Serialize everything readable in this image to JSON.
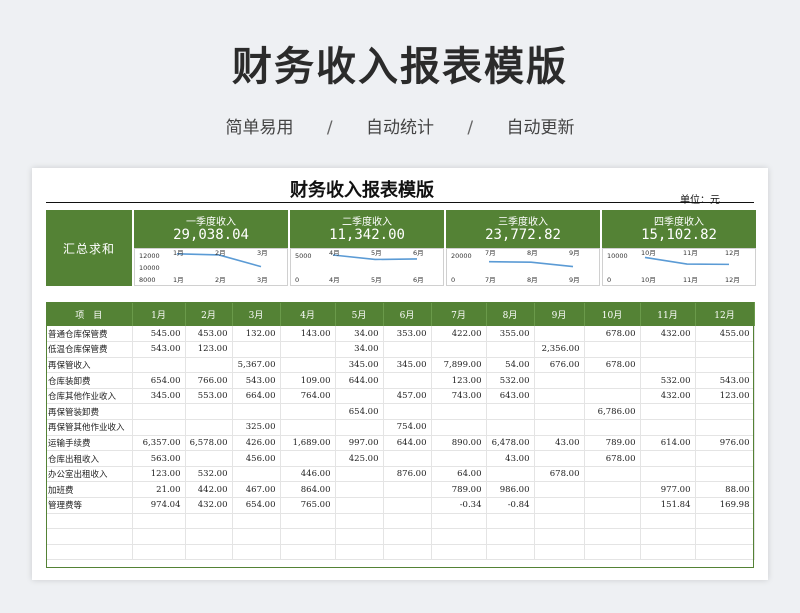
{
  "header": {
    "title": "财务收入报表模版"
  },
  "subtitle": {
    "items": [
      "简单易用",
      "自动统计",
      "自动更新"
    ],
    "separator": "/"
  },
  "sheet": {
    "title": "财务收入报表模版",
    "unit": "单位：元"
  },
  "summary": {
    "label": "汇总求和",
    "quarters": [
      {
        "name": "一季度收入",
        "total": "29,038.04",
        "months": [
          "1月",
          "2月",
          "3月"
        ],
        "values": [
          12345.0,
          12012.0,
          8678.0
        ],
        "ticks": [
          "12000",
          "10000",
          "8000"
        ]
      },
      {
        "name": "二季度收入",
        "total": "11,342.00",
        "months": [
          "4月",
          "5月",
          "6月"
        ],
        "values": [
          5000,
          3400,
          3600
        ],
        "ticks": [
          "5000",
          "0"
        ]
      },
      {
        "name": "三季度收入",
        "total": "23,772.82",
        "months": [
          "7月",
          "8月",
          "9月"
        ],
        "values": [
          10500,
          9700,
          3500
        ],
        "ticks": [
          "20000",
          "0"
        ]
      },
      {
        "name": "四季度收入",
        "total": "15,102.82",
        "months": [
          "10月",
          "11月",
          "12月"
        ],
        "values": [
          8254,
          3548,
          3300
        ],
        "ticks": [
          "10000",
          "0"
        ]
      }
    ]
  },
  "table": {
    "headers": [
      "项　目",
      "1月",
      "2月",
      "3月",
      "4月",
      "5月",
      "6月",
      "7月",
      "8月",
      "9月",
      "10月",
      "11月",
      "12月"
    ],
    "rows": [
      [
        "普通仓库保管费",
        "545.00",
        "453.00",
        "132.00",
        "143.00",
        "34.00",
        "353.00",
        "422.00",
        "355.00",
        "",
        "678.00",
        "432.00",
        "455.00"
      ],
      [
        "低温仓库保管费",
        "543.00",
        "123.00",
        "",
        "",
        "34.00",
        "",
        "",
        "",
        "2,356.00",
        "",
        "",
        ""
      ],
      [
        "再保管收入",
        "",
        "",
        "5,367.00",
        "",
        "345.00",
        "345.00",
        "7,899.00",
        "54.00",
        "676.00",
        "678.00",
        "",
        ""
      ],
      [
        "仓库装卸费",
        "654.00",
        "766.00",
        "543.00",
        "109.00",
        "644.00",
        "",
        "123.00",
        "532.00",
        "",
        "",
        "532.00",
        "543.00"
      ],
      [
        "仓库其他作业收入",
        "345.00",
        "553.00",
        "664.00",
        "764.00",
        "",
        "457.00",
        "743.00",
        "643.00",
        "",
        "",
        "432.00",
        "123.00"
      ],
      [
        "再保管装卸费",
        "",
        "",
        "",
        "",
        "654.00",
        "",
        "",
        "",
        "",
        "6,786.00",
        "",
        ""
      ],
      [
        "再保管其他作业收入",
        "",
        "",
        "325.00",
        "",
        "",
        "754.00",
        "",
        "",
        "",
        "",
        "",
        ""
      ],
      [
        "运输手续费",
        "6,357.00",
        "6,578.00",
        "426.00",
        "1,689.00",
        "997.00",
        "644.00",
        "890.00",
        "6,478.00",
        "43.00",
        "789.00",
        "614.00",
        "976.00"
      ],
      [
        "仓库出租收入",
        "563.00",
        "",
        "456.00",
        "",
        "425.00",
        "",
        "",
        "43.00",
        "",
        "678.00",
        "",
        ""
      ],
      [
        "办公室出租收入",
        "123.00",
        "532.00",
        "",
        "446.00",
        "",
        "876.00",
        "64.00",
        "",
        "678.00",
        "",
        "",
        ""
      ],
      [
        "加班费",
        "21.00",
        "442.00",
        "467.00",
        "864.00",
        "",
        "",
        "789.00",
        "986.00",
        "",
        "",
        "977.00",
        "88.00"
      ],
      [
        "管理费等",
        "974.04",
        "432.00",
        "654.00",
        "765.00",
        "",
        "",
        "-0.34",
        "-0.84",
        "",
        "",
        "151.84",
        "169.98"
      ],
      [
        "",
        "",
        "",
        "",
        "",
        "",
        "",
        "",
        "",
        "",
        "",
        "",
        ""
      ],
      [
        "",
        "",
        "",
        "",
        "",
        "",
        "",
        "",
        "",
        "",
        "",
        "",
        ""
      ],
      [
        "",
        "",
        "",
        "",
        "",
        "",
        "",
        "",
        "",
        "",
        "",
        "",
        ""
      ]
    ]
  },
  "colors": {
    "accent_green": "#548235",
    "line_blue": "#5b9bd5"
  }
}
